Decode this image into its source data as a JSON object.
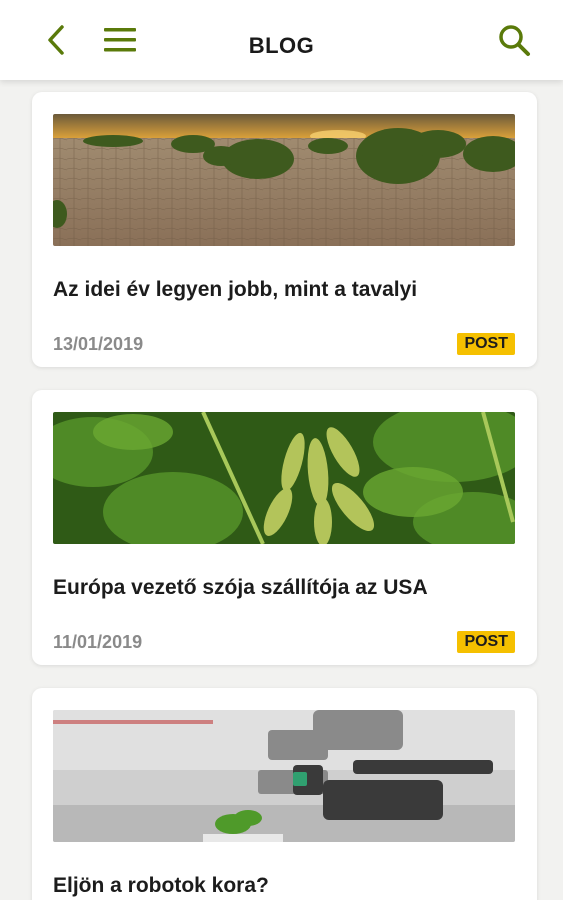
{
  "header": {
    "title": "BLOG"
  },
  "colors": {
    "accent": "#5a7a0a",
    "badge": "#f5c000"
  },
  "posts": [
    {
      "title": "Az idei év legyen jobb, mint a tavalyi",
      "date": "13/01/2019",
      "tag": "POST"
    },
    {
      "title": "Európa vezető szója szállítója az USA",
      "date": "11/01/2019",
      "tag": "POST"
    },
    {
      "title": "Eljön a robotok kora?"
    }
  ]
}
